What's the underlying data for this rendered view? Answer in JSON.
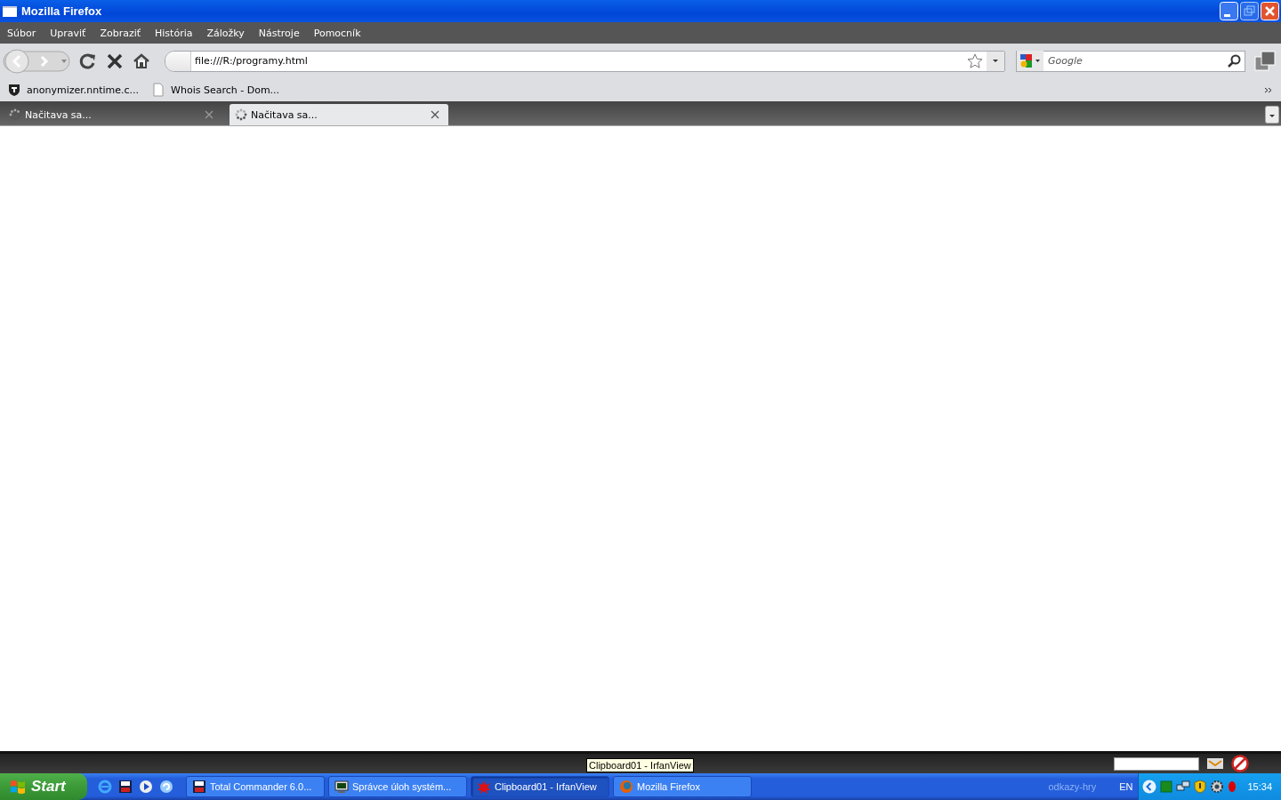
{
  "window": {
    "title": "Mozilla Firefox"
  },
  "menu": [
    "Súbor",
    "Upraviť",
    "Zobraziť",
    "História",
    "Záložky",
    "Nástroje",
    "Pomocník"
  ],
  "address": {
    "value": "file:///R:/programy.html"
  },
  "search": {
    "placeholder": "Google"
  },
  "bookmarks": [
    {
      "label": "anonymizer.nntime.c...",
      "kind": "site"
    },
    {
      "label": "Whois Search - Dom...",
      "kind": "page"
    }
  ],
  "tabs": [
    {
      "label": "Načitava sa...",
      "selected": false
    },
    {
      "label": "Načitava sa...",
      "selected": true
    }
  ],
  "taskbar": {
    "start": "Start",
    "tasks": [
      {
        "label": "Total Commander 6.0...",
        "kind": "disk",
        "selected": false
      },
      {
        "label": "Správce úloh systém...",
        "kind": "monitor",
        "selected": false
      },
      {
        "label": "Clipboard01 - IrfanView",
        "kind": "irfan",
        "selected": true
      },
      {
        "label": "Mozilla Firefox",
        "kind": "firefox",
        "selected": false
      }
    ],
    "toolbar_label": "odkazy-hry",
    "language": "EN",
    "clock": "15:34"
  },
  "tooltip": "Clipboard01 - IrfanView"
}
